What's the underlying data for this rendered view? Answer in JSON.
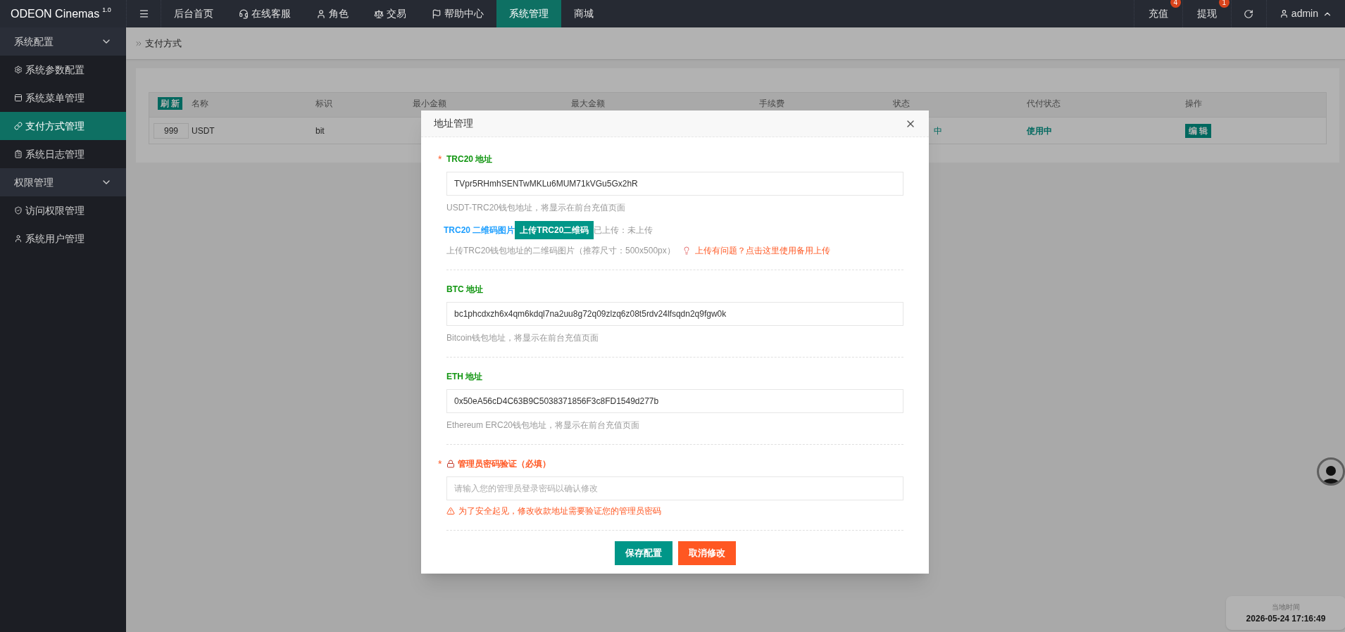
{
  "brand": {
    "name": "ODEON Cinemas",
    "version": "1.0"
  },
  "top_nav": [
    {
      "label": "后台首页",
      "selected": false
    },
    {
      "label": "在线客服",
      "selected": false
    },
    {
      "label": "角色",
      "selected": false
    },
    {
      "label": "交易",
      "selected": false
    },
    {
      "label": "帮助中心",
      "selected": false
    },
    {
      "label": "系统管理",
      "selected": true
    },
    {
      "label": "商城",
      "selected": false
    }
  ],
  "top_right": [
    {
      "label": "充值",
      "badge": "4"
    },
    {
      "label": "提现",
      "badge": "1"
    }
  ],
  "user": "admin",
  "sidebar": [
    {
      "label": "系统配置",
      "expanded": true,
      "items": [
        {
          "label": "系统参数配置",
          "selected": false
        },
        {
          "label": "系统菜单管理",
          "selected": false
        },
        {
          "label": "支付方式管理",
          "selected": true
        },
        {
          "label": "系统日志管理",
          "selected": false
        }
      ]
    },
    {
      "label": "权限管理",
      "expanded": true,
      "items": [
        {
          "label": "访问权限管理",
          "selected": false
        },
        {
          "label": "系统用户管理",
          "selected": false
        }
      ]
    }
  ],
  "breadcrumb": "支付方式",
  "table": {
    "refresh_button": "刷 新",
    "columns": [
      "名称",
      "标识",
      "最小金额",
      "最大金额",
      "手续费",
      "状态",
      "代付状态",
      "操作"
    ],
    "rows": [
      {
        "sort": "999",
        "name": "USDT",
        "code": "bit",
        "status": "中",
        "payout_status": "使用中",
        "action": "编 辑"
      }
    ]
  },
  "modal": {
    "title": "地址管理",
    "required_mark": "*",
    "fields": [
      {
        "kind": "address",
        "required": true,
        "label": "TRC20 地址",
        "value": "TVpr5RHmhSENTwMKLu6MUM71kVGu5Gx2hR",
        "hint": "USDT-TRC20钱包地址，将显示在前台充值页面"
      },
      {
        "kind": "upload",
        "required": false,
        "label": "TRC20 二维码图片",
        "button": "上传TRC20二维码",
        "status": "已上传：未上传",
        "hint": "上传TRC20钱包地址的二维码图片（推荐尺寸：500x500px）",
        "help_link": "上传有问题？点击这里使用备用上传"
      },
      {
        "kind": "address",
        "required": false,
        "label": "BTC 地址",
        "value": "bc1phcdxzh6x4qm6kdql7na2uu8g72q09zlzq6z08t5rdv24lfsqdn2q9fgw0k",
        "hint": "Bitcoin钱包地址，将显示在前台充值页面"
      },
      {
        "kind": "address",
        "required": false,
        "label": "ETH 地址",
        "value": "0x50eA56cD4C63B9C5038371856F3c8FD1549d277b",
        "hint": "Ethereum ERC20钱包地址，将显示在前台充值页面"
      },
      {
        "kind": "password",
        "required": true,
        "label": "管理员密码验证（必填）",
        "placeholder": "请输入您的管理员登录密码以确认修改",
        "warning": "为了安全起见，修改收款地址需要验证您的管理员密码"
      }
    ],
    "buttons": [
      {
        "label": "保存配置",
        "kind": "primary"
      },
      {
        "label": "取消修改",
        "kind": "danger"
      }
    ]
  },
  "clock": {
    "label": "当地时间",
    "value": "2026-05-24 17:16:49"
  }
}
